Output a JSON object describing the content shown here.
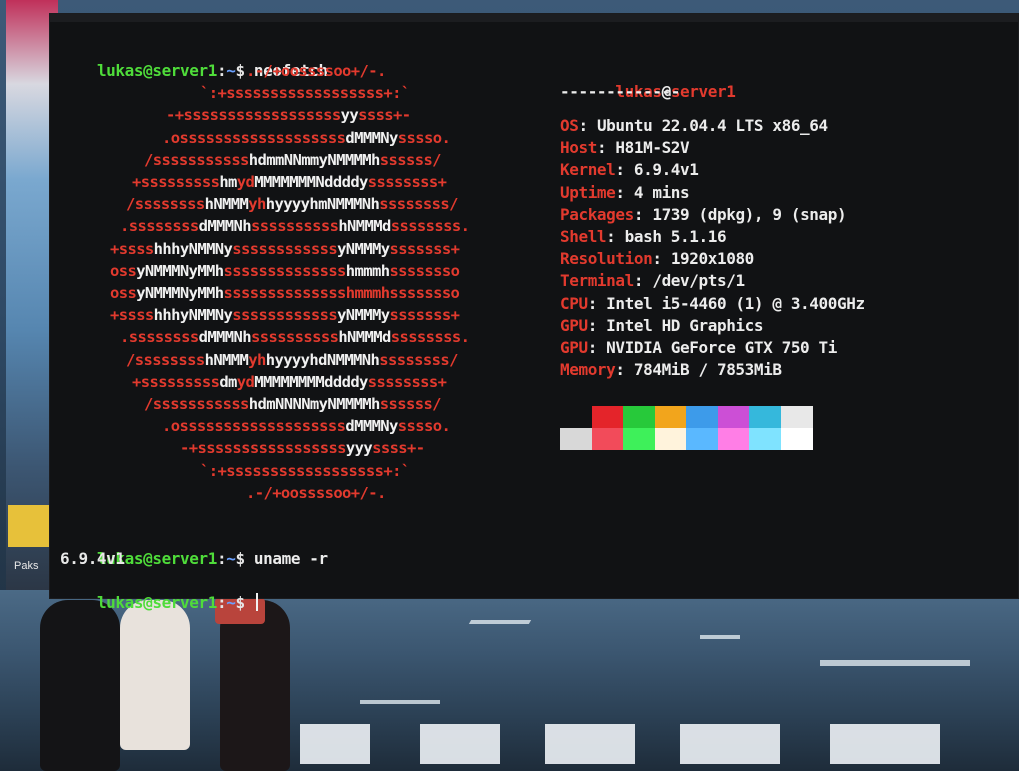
{
  "wallpaper": {
    "label": "Paks"
  },
  "terminal": {
    "prompt": {
      "user_host": "lukas@server1",
      "colon": ":",
      "path": "~",
      "symbol": "$"
    },
    "commands": [
      {
        "cmd": "neofetch"
      },
      {
        "cmd": "uname -r",
        "output": "6.9.4v1"
      },
      {
        "cmd": ""
      }
    ],
    "ascii_art": [
      [
        [
          "r",
          ".-/+oossssoo+/-."
        ]
      ],
      [
        [
          "r",
          "`:+ssssssssssssssssss+:`"
        ]
      ],
      [
        [
          "r",
          "-+ssssssssssssssssss"
        ],
        [
          "w",
          "yy"
        ],
        [
          "r",
          "ssss+-"
        ]
      ],
      [
        [
          "r",
          ".osssssssssssssssssss"
        ],
        [
          "w",
          "dMMMNy"
        ],
        [
          "r",
          "sssso."
        ]
      ],
      [
        [
          "r",
          "/sssssssssss"
        ],
        [
          "w",
          "hdmmNNmmyNMMMMh"
        ],
        [
          "r",
          "ssssss/"
        ]
      ],
      [
        [
          "r",
          "+sssssssss"
        ],
        [
          "w",
          "hm"
        ],
        [
          "r",
          "yd"
        ],
        [
          "w",
          "MMMMMMMNddddy"
        ],
        [
          "r",
          "ssssssss+"
        ]
      ],
      [
        [
          "r",
          "/ssssssss"
        ],
        [
          "w",
          "hNMMM"
        ],
        [
          "r",
          "yh"
        ],
        [
          "w",
          "hyyyyhmNMMMNh"
        ],
        [
          "r",
          "ssssssss/"
        ]
      ],
      [
        [
          "r",
          ".ssssssss"
        ],
        [
          "w",
          "dMMMNh"
        ],
        [
          "r",
          "ssssssssss"
        ],
        [
          "w",
          "hNMMMd"
        ],
        [
          "r",
          "ssssssss."
        ]
      ],
      [
        [
          "r",
          "+ssss"
        ],
        [
          "w",
          "hhhyNMMNy"
        ],
        [
          "r",
          "ssssssssssss"
        ],
        [
          "w",
          "yNMMMy"
        ],
        [
          "r",
          "sssssss+"
        ]
      ],
      [
        [
          "r",
          "oss"
        ],
        [
          "w",
          "yNMMMNyMMh"
        ],
        [
          "r",
          "ssssssssssssss"
        ],
        [
          "w",
          "hmmmh"
        ],
        [
          "r",
          "ssssssso"
        ]
      ],
      [
        [
          "r",
          "oss"
        ],
        [
          "w",
          "yNMMMNyMMh"
        ],
        [
          "r",
          "sssssssssssssshmmmhssssssso"
        ]
      ],
      [
        [
          "r",
          "+ssss"
        ],
        [
          "w",
          "hhhyNMMNy"
        ],
        [
          "r",
          "ssssssssssss"
        ],
        [
          "w",
          "yNMMMy"
        ],
        [
          "r",
          "sssssss+"
        ]
      ],
      [
        [
          "r",
          ".ssssssss"
        ],
        [
          "w",
          "dMMMNh"
        ],
        [
          "r",
          "ssssssssss"
        ],
        [
          "w",
          "hNMMMd"
        ],
        [
          "r",
          "ssssssss."
        ]
      ],
      [
        [
          "r",
          "/ssssssss"
        ],
        [
          "w",
          "hNMMM"
        ],
        [
          "r",
          "yh"
        ],
        [
          "w",
          "hyyyyhdNMMMNh"
        ],
        [
          "r",
          "ssssssss/"
        ]
      ],
      [
        [
          "r",
          "+sssssssss"
        ],
        [
          "w",
          "dm"
        ],
        [
          "r",
          "yd"
        ],
        [
          "w",
          "MMMMMMMMddddy"
        ],
        [
          "r",
          "ssssssss+"
        ]
      ],
      [
        [
          "r",
          "/sssssssssss"
        ],
        [
          "w",
          "hdmNNNNmyNMMMMh"
        ],
        [
          "r",
          "ssssss/"
        ]
      ],
      [
        [
          "r",
          ".osssssssssssssssssss"
        ],
        [
          "w",
          "dMMMNy"
        ],
        [
          "r",
          "sssso."
        ]
      ],
      [
        [
          "r",
          "-+sssssssssssssssss"
        ],
        [
          "w",
          "yyy"
        ],
        [
          "r",
          "ssss+-"
        ]
      ],
      [
        [
          "r",
          "`:+ssssssssssssssssss+:`"
        ]
      ],
      [
        [
          "r",
          ".-/+oossssoo+/-."
        ]
      ]
    ],
    "info": {
      "title_user": "lukas",
      "title_at": "@",
      "title_host": "server1",
      "separator": "-------------",
      "rows": [
        {
          "key": "OS",
          "value": "Ubuntu 22.04.4 LTS x86_64"
        },
        {
          "key": "Host",
          "value": "H81M-S2V"
        },
        {
          "key": "Kernel",
          "value": "6.9.4v1"
        },
        {
          "key": "Uptime",
          "value": "4 mins"
        },
        {
          "key": "Packages",
          "value": "1739 (dpkg), 9 (snap)"
        },
        {
          "key": "Shell",
          "value": "bash 5.1.16"
        },
        {
          "key": "Resolution",
          "value": "1920x1080"
        },
        {
          "key": "Terminal",
          "value": "/dev/pts/1"
        },
        {
          "key": "CPU",
          "value": "Intel i5-4460 (1) @ 3.400GHz"
        },
        {
          "key": "GPU",
          "value": "Intel HD Graphics"
        },
        {
          "key": "GPU",
          "value": "NVIDIA GeForce GTX 750 Ti"
        },
        {
          "key": "Memory",
          "value": "784MiB / 7853MiB"
        }
      ]
    },
    "palette_top": [
      "#111214",
      "#e4242a",
      "#27c93a",
      "#f2a51c",
      "#3d9bea",
      "#cc4fd6",
      "#35b8dc",
      "#e8e8e8"
    ],
    "palette_bottom": [
      "#d8d8d8",
      "#f24b5a",
      "#3ef05a",
      "#fff3dc",
      "#5ab8ff",
      "#ff7ee6",
      "#7fe3ff",
      "#ffffff"
    ]
  }
}
